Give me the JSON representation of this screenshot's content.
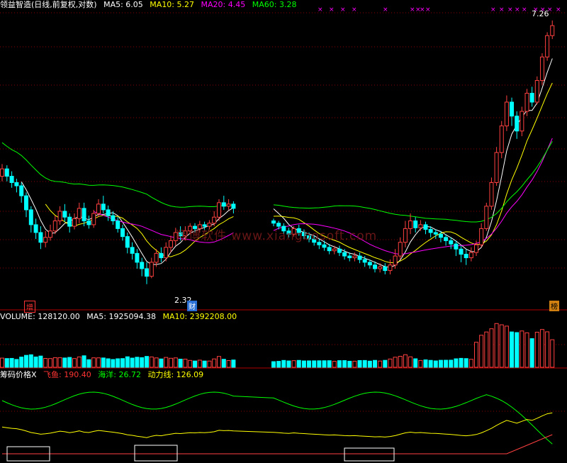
{
  "price_panel": {
    "title": "领益智造(日线,前复权,对数)",
    "ma": [
      {
        "label": "MA5: 6.05",
        "color": "#ffffff"
      },
      {
        "label": "MA10: 5.27",
        "color": "#ffff00"
      },
      {
        "label": "MA20: 4.45",
        "color": "#ff00ff"
      },
      {
        "label": "MA60: 3.28",
        "color": "#00ff00"
      }
    ],
    "high_label": "7.26",
    "low_label": "2.32",
    "tag_zeng": "增",
    "tag_cai": "财",
    "tag_bang": "榜",
    "watermark": "翔博软件 www.xiangbosoft.com"
  },
  "volume_panel": {
    "labels": [
      {
        "text": "VOLUME: 128120.00",
        "color": "#ffffff"
      },
      {
        "text": "MA5: 1925094.38",
        "color": "#ffffff"
      },
      {
        "text": "MA10: 2392208.00",
        "color": "#ffff00"
      }
    ]
  },
  "indicator_panel": {
    "labels": [
      {
        "text": "筹码价格X",
        "color": "#ffffff"
      },
      {
        "text": "飞鱼: 190.40",
        "color": "#ff3333"
      },
      {
        "text": "海洋: 26.72",
        "color": "#00ff00"
      },
      {
        "text": "动力线: 126.09",
        "color": "#ffff00"
      }
    ]
  },
  "colors": {
    "up": "#ff4040",
    "down": "#00ffff",
    "ma5": "#ffffff",
    "ma10": "#ffff00",
    "ma20": "#ff00ff",
    "ma60": "#00ff00",
    "grid": "#8b0000",
    "marker": "#ff00ff"
  },
  "chart_data": {
    "type": "candlestick",
    "price_scale": "log",
    "price_range": [
      2.2,
      7.6
    ],
    "candles": [
      [
        3.7,
        3.82,
        3.9,
        3.62
      ],
      [
        3.82,
        3.7,
        3.88,
        3.62
      ],
      [
        3.7,
        3.6,
        3.78,
        3.52
      ],
      [
        3.6,
        3.55,
        3.66,
        3.45
      ],
      [
        3.55,
        3.4,
        3.6,
        3.3
      ],
      [
        3.4,
        3.2,
        3.45,
        3.1
      ],
      [
        3.2,
        3.0,
        3.25,
        2.9
      ],
      [
        3.0,
        2.9,
        3.08,
        2.82
      ],
      [
        2.9,
        2.78,
        2.98,
        2.7
      ],
      [
        2.78,
        2.84,
        2.92,
        2.72
      ],
      [
        2.84,
        2.92,
        3.0,
        2.8
      ],
      [
        2.92,
        3.05,
        3.12,
        2.88
      ],
      [
        3.05,
        3.18,
        3.25,
        3.0
      ],
      [
        3.18,
        3.1,
        3.28,
        3.04
      ],
      [
        3.1,
        2.98,
        3.15,
        2.9
      ],
      [
        2.98,
        3.08,
        3.15,
        2.94
      ],
      [
        3.08,
        3.22,
        3.3,
        3.02
      ],
      [
        3.22,
        3.05,
        3.3,
        2.98
      ],
      [
        3.05,
        3.0,
        3.12,
        2.95
      ],
      [
        3.0,
        3.15,
        3.2,
        2.96
      ],
      [
        3.15,
        3.28,
        3.35,
        3.1
      ],
      [
        3.28,
        3.2,
        3.4,
        3.15
      ],
      [
        3.2,
        3.12,
        3.26,
        3.05
      ],
      [
        3.12,
        3.05,
        3.18,
        3.0
      ],
      [
        3.05,
        2.95,
        3.1,
        2.9
      ],
      [
        2.95,
        2.85,
        3.0,
        2.8
      ],
      [
        2.85,
        2.72,
        2.9,
        2.65
      ],
      [
        2.72,
        2.65,
        2.78,
        2.58
      ],
      [
        2.65,
        2.55,
        2.7,
        2.48
      ],
      [
        2.55,
        2.48,
        2.6,
        2.4
      ],
      [
        2.48,
        2.4,
        2.55,
        2.32
      ],
      [
        2.4,
        2.55,
        2.6,
        2.38
      ],
      [
        2.55,
        2.65,
        2.7,
        2.5
      ],
      [
        2.65,
        2.6,
        2.72,
        2.55
      ],
      [
        2.6,
        2.72,
        2.78,
        2.56
      ],
      [
        2.72,
        2.8,
        2.86,
        2.66
      ],
      [
        2.8,
        2.9,
        2.96,
        2.74
      ],
      [
        2.9,
        2.86,
        2.98,
        2.8
      ],
      [
        2.86,
        2.92,
        2.98,
        2.8
      ],
      [
        2.92,
        2.98,
        3.02,
        2.88
      ],
      [
        2.98,
        2.95,
        3.02,
        2.9
      ],
      [
        2.95,
        3.0,
        3.05,
        2.9
      ],
      [
        3.0,
        2.98,
        3.04,
        2.92
      ],
      [
        2.98,
        3.02,
        3.06,
        2.94
      ],
      [
        3.02,
        3.1,
        3.18,
        2.98
      ],
      [
        3.1,
        3.3,
        3.35,
        3.05
      ],
      [
        3.3,
        3.25,
        3.4,
        3.2
      ],
      [
        3.25,
        3.28,
        3.35,
        3.2
      ],
      [
        3.28,
        3.22,
        3.32,
        3.15
      ],
      [
        3.05,
        3.02,
        3.08,
        2.98
      ],
      [
        3.02,
        2.98,
        3.05,
        2.94
      ],
      [
        2.98,
        2.92,
        3.02,
        2.88
      ],
      [
        2.92,
        2.88,
        2.96,
        2.84
      ],
      [
        2.88,
        2.95,
        2.98,
        2.85
      ],
      [
        2.95,
        2.9,
        3.0,
        2.86
      ],
      [
        2.9,
        2.86,
        2.94,
        2.82
      ],
      [
        2.86,
        2.82,
        2.9,
        2.78
      ],
      [
        2.82,
        2.78,
        2.86,
        2.74
      ],
      [
        2.78,
        2.75,
        2.82,
        2.7
      ],
      [
        2.75,
        2.72,
        2.8,
        2.68
      ],
      [
        2.72,
        2.68,
        2.76,
        2.64
      ],
      [
        2.68,
        2.7,
        2.74,
        2.64
      ],
      [
        2.7,
        2.66,
        2.74,
        2.62
      ],
      [
        2.66,
        2.62,
        2.7,
        2.58
      ],
      [
        2.62,
        2.6,
        2.66,
        2.56
      ],
      [
        2.6,
        2.62,
        2.66,
        2.56
      ],
      [
        2.62,
        2.58,
        2.66,
        2.54
      ],
      [
        2.58,
        2.55,
        2.62,
        2.5
      ],
      [
        2.55,
        2.52,
        2.58,
        2.48
      ],
      [
        2.52,
        2.48,
        2.56,
        2.44
      ],
      [
        2.48,
        2.5,
        2.54,
        2.44
      ],
      [
        2.5,
        2.46,
        2.54,
        2.42
      ],
      [
        2.46,
        2.52,
        2.58,
        2.42
      ],
      [
        2.52,
        2.62,
        2.7,
        2.48
      ],
      [
        2.62,
        2.78,
        2.84,
        2.58
      ],
      [
        2.78,
        2.95,
        3.05,
        2.72
      ],
      [
        2.95,
        3.05,
        3.15,
        2.88
      ],
      [
        3.05,
        2.96,
        3.1,
        2.9
      ],
      [
        2.96,
        3.0,
        3.06,
        2.92
      ],
      [
        3.0,
        2.94,
        3.04,
        2.88
      ],
      [
        2.94,
        2.9,
        2.98,
        2.84
      ],
      [
        2.9,
        2.88,
        2.94,
        2.82
      ],
      [
        2.88,
        2.84,
        2.92,
        2.78
      ],
      [
        2.84,
        2.8,
        2.88,
        2.74
      ],
      [
        2.8,
        2.76,
        2.84,
        2.7
      ],
      [
        2.76,
        2.7,
        2.8,
        2.62
      ],
      [
        2.7,
        2.64,
        2.74,
        2.55
      ],
      [
        2.64,
        2.6,
        2.7,
        2.52
      ],
      [
        2.6,
        2.66,
        2.72,
        2.56
      ],
      [
        2.66,
        2.75,
        2.8,
        2.62
      ],
      [
        2.75,
        2.95,
        3.02,
        2.72
      ],
      [
        2.95,
        3.25,
        3.3,
        2.92
      ],
      [
        3.25,
        3.6,
        3.68,
        3.2
      ],
      [
        3.6,
        4.1,
        4.2,
        3.55
      ],
      [
        4.1,
        4.6,
        4.7,
        4.0
      ],
      [
        4.6,
        5.1,
        5.25,
        4.5
      ],
      [
        5.1,
        4.8,
        5.2,
        4.6
      ],
      [
        4.8,
        4.5,
        4.9,
        4.35
      ],
      [
        4.5,
        4.9,
        5.0,
        4.4
      ],
      [
        4.9,
        5.3,
        5.4,
        4.8
      ],
      [
        5.3,
        5.1,
        5.45,
        5.0
      ],
      [
        5.1,
        5.6,
        5.7,
        5.05
      ],
      [
        5.6,
        6.2,
        6.3,
        5.5
      ],
      [
        6.2,
        6.8,
        6.9,
        6.1
      ],
      [
        6.8,
        7.1,
        7.26,
        6.7
      ]
    ]
  }
}
